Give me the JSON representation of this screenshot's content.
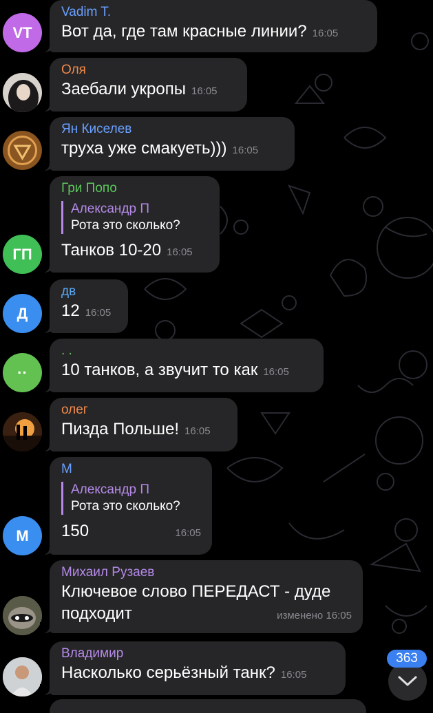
{
  "colors": {
    "background": "#000000",
    "bubble": "#262628",
    "time": "#8a8a90",
    "reply_accent": "#b58ae8",
    "badge": "#3b80f0"
  },
  "messages": [
    {
      "sender": "Vadim T.",
      "sender_color": "#6aa0ff",
      "avatar": "VT",
      "avatar_color": "#c06ae8",
      "text": "Вот да, где там красные линии?",
      "time": "16:05"
    },
    {
      "sender": "Оля",
      "sender_color": "#f08a4b",
      "avatar": "",
      "avatar_icon": "photo-avatar-icon",
      "text": "Заебали укропы",
      "time": "16:05"
    },
    {
      "sender": "Ян Киселев",
      "sender_color": "#6aa0ff",
      "avatar": "",
      "avatar_icon": "emblem-avatar-icon",
      "text": "труха уже смакуеть)))",
      "time": "16:05"
    },
    {
      "sender": "Гри Попо",
      "sender_color": "#5cc85c",
      "avatar": "ГП",
      "avatar_color": "#3fbf56",
      "reply_name": "Александр П",
      "reply_text": "Рота это сколько?",
      "text": "Танков 10-20",
      "time": "16:05"
    },
    {
      "sender": "дв",
      "sender_color": "#5aa9f5",
      "avatar": "Д",
      "avatar_color": "#3a8ef0",
      "text": "12",
      "time": "16:05"
    },
    {
      "sender": ". .",
      "sender_color": "#5cc85c",
      "avatar": "··",
      "avatar_color": "#62c150",
      "text": "10 танков, а звучит то как",
      "time": "16:05"
    },
    {
      "sender": "олег",
      "sender_color": "#f08a4b",
      "avatar": "",
      "avatar_icon": "sunset-photo-avatar-icon",
      "text": "Пизда Польше!",
      "time": "16:05"
    },
    {
      "sender": "М",
      "sender_color": "#6aa0ff",
      "avatar": "М",
      "avatar_color": "#3a8ef0",
      "reply_name": "Александр П",
      "reply_text": "Рота это сколько?",
      "text": "150",
      "time": "16:05"
    },
    {
      "sender": "Михаил Рузаев",
      "sender_color": "#b58ae8",
      "avatar": "",
      "avatar_icon": "raccoon-photo-avatar-icon",
      "text": "Ключевое слово ПЕРЕДАСТ - дуде",
      "text2": "подходит",
      "edited": "изменено",
      "time": "16:05"
    },
    {
      "sender": "Владимир",
      "sender_color": "#b58ae8",
      "avatar": "",
      "avatar_icon": "person-photo-avatar-icon",
      "text": "Насколько серьёзный танк?",
      "time": "16:05"
    }
  ],
  "unread_count": "363"
}
